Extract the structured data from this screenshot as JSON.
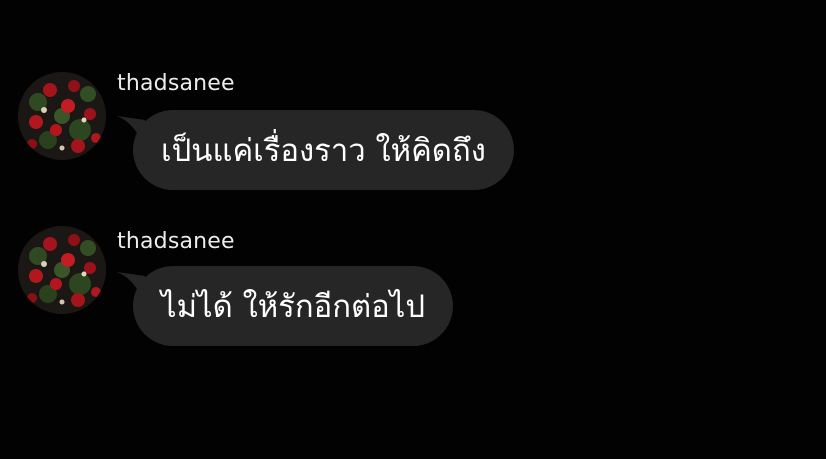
{
  "colors": {
    "background": "#020202",
    "bubble": "#262626",
    "text": "#ffffff",
    "username": "#ececec"
  },
  "messages": [
    {
      "username": "thadsanee",
      "text": "เป็นแค่เรื่องราว ให้คิดถึง",
      "avatar_icon": "red-roses-avatar-icon"
    },
    {
      "username": "thadsanee",
      "text": "ไม่ได้ ให้รักอีกต่อไป",
      "avatar_icon": "red-roses-avatar-icon"
    }
  ]
}
